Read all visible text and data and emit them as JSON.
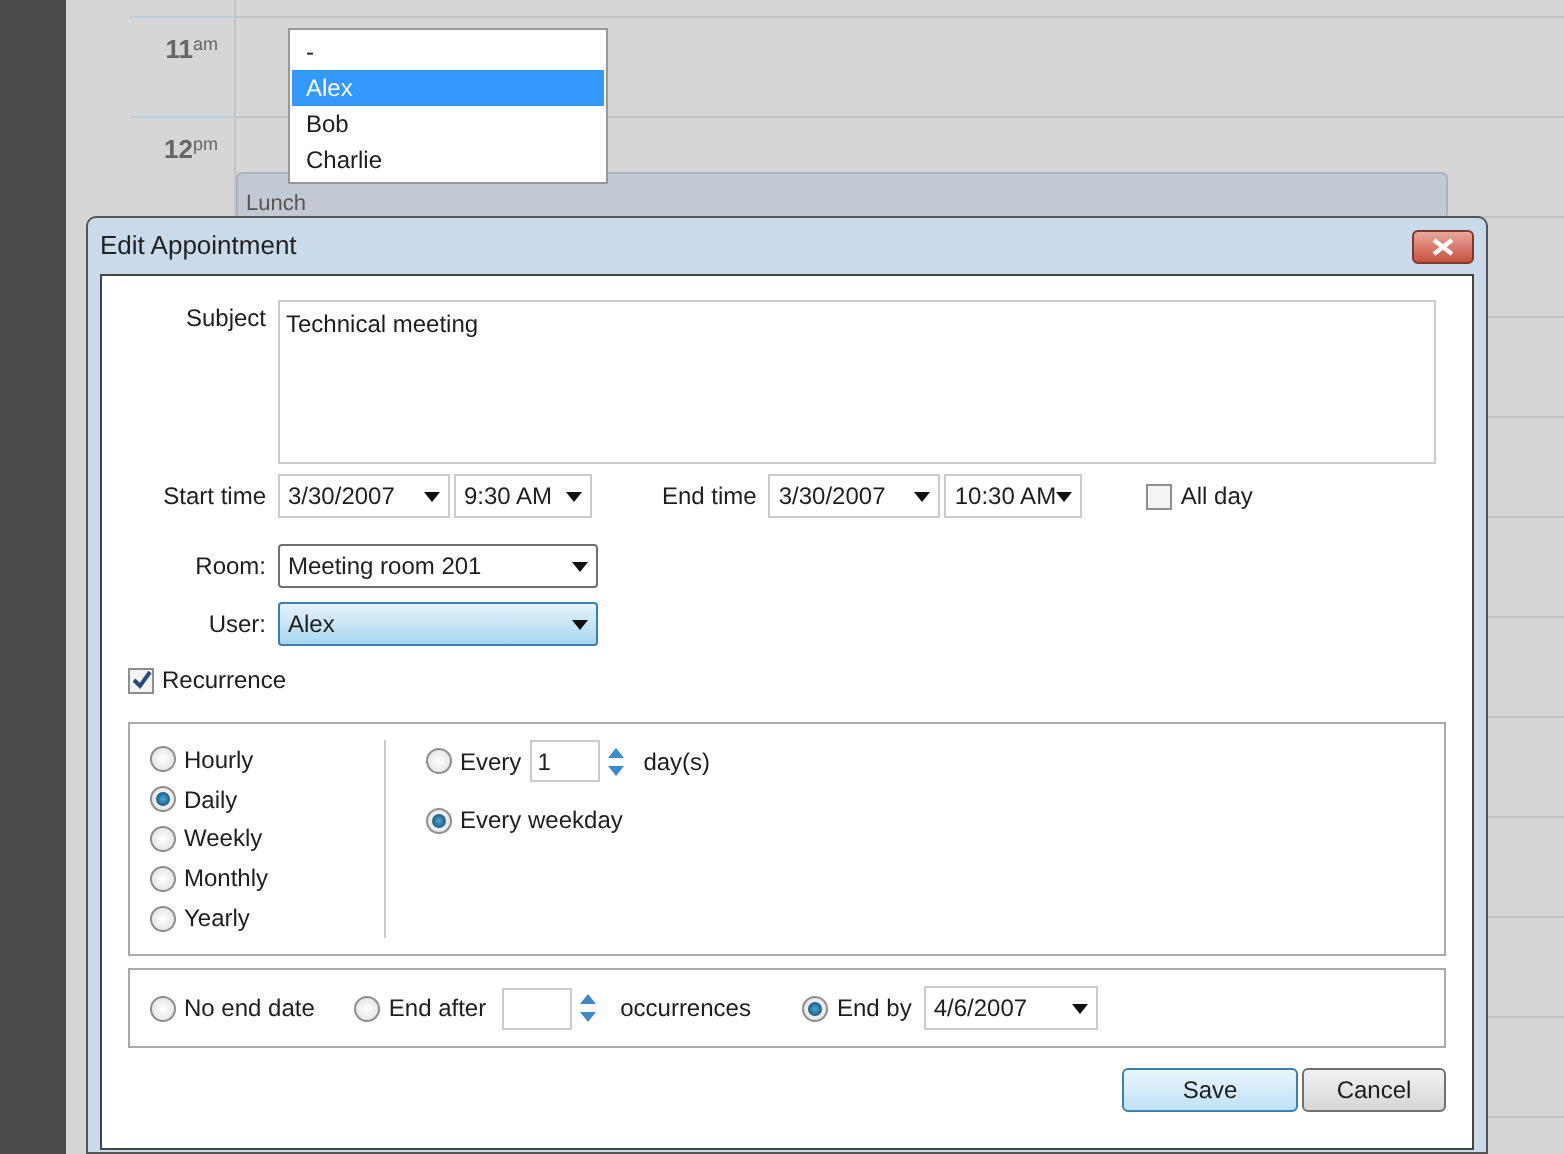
{
  "calendar": {
    "time_slots": [
      {
        "hour": "11",
        "suffix": "am"
      },
      {
        "hour": "12",
        "suffix": "pm"
      }
    ],
    "events": [
      {
        "title": "Lunch"
      }
    ]
  },
  "user_dropdown_list": {
    "items": [
      {
        "label": "-",
        "selected": false
      },
      {
        "label": "Alex",
        "selected": true
      },
      {
        "label": "Bob",
        "selected": false
      },
      {
        "label": "Charlie",
        "selected": false
      }
    ]
  },
  "dialog": {
    "title": "Edit Appointment",
    "subject": {
      "label": "Subject",
      "value": "Technical meeting"
    },
    "start": {
      "label": "Start time",
      "date": "3/30/2007",
      "time": "9:30 AM"
    },
    "end": {
      "label": "End time",
      "date": "3/30/2007",
      "time": "10:30 AM"
    },
    "all_day": {
      "label": "All day",
      "checked": false
    },
    "room": {
      "label": "Room:",
      "value": "Meeting room 201",
      "expanded": false
    },
    "user": {
      "label": "User:",
      "value": "Alex",
      "expanded": true
    },
    "recurrence": {
      "label": "Recurrence",
      "checked": true
    },
    "patterns": [
      {
        "label": "Hourly",
        "selected": false
      },
      {
        "label": "Daily",
        "selected": true
      },
      {
        "label": "Weekly",
        "selected": false
      },
      {
        "label": "Monthly",
        "selected": false
      },
      {
        "label": "Yearly",
        "selected": false
      }
    ],
    "daily_options": [
      {
        "kind": "every",
        "label": "Every",
        "value": "1",
        "suffix": "day(s)",
        "selected": false
      },
      {
        "kind": "weekday",
        "label": "Every weekday",
        "selected": true
      }
    ],
    "range": [
      {
        "kind": "none",
        "label": "No end date",
        "selected": false
      },
      {
        "kind": "after",
        "label": "End after",
        "suffix": "occurrences",
        "selected": false
      },
      {
        "kind": "by",
        "label": "End by",
        "value": "4/6/2007",
        "selected": true
      }
    ],
    "buttons": [
      {
        "label": "Save",
        "kind": "primary"
      },
      {
        "label": "Cancel",
        "kind": "secondary"
      }
    ]
  }
}
